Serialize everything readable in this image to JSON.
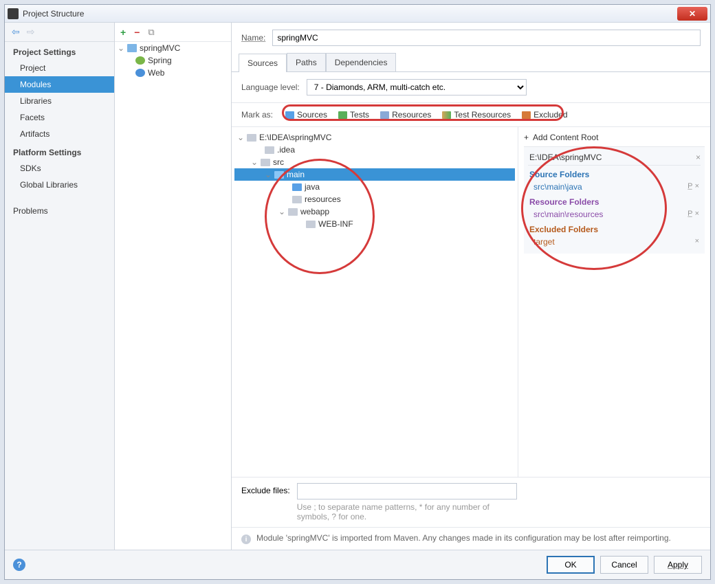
{
  "window": {
    "title": "Project Structure"
  },
  "sidebar": {
    "sections": [
      {
        "title": "Project Settings",
        "items": [
          "Project",
          "Modules",
          "Libraries",
          "Facets",
          "Artifacts"
        ],
        "selected": 1
      },
      {
        "title": "Platform Settings",
        "items": [
          "SDKs",
          "Global Libraries"
        ]
      }
    ],
    "extra": [
      "Problems"
    ]
  },
  "modules": {
    "root": "springMVC",
    "children": [
      "Spring",
      "Web"
    ]
  },
  "name": {
    "label": "Name:",
    "value": "springMVC"
  },
  "tabs": {
    "items": [
      "Sources",
      "Paths",
      "Dependencies"
    ],
    "active": 0
  },
  "language": {
    "label": "Language level:",
    "selected": "7 - Diamonds, ARM, multi-catch etc."
  },
  "markAs": {
    "label": "Mark as:",
    "options": [
      "Sources",
      "Tests",
      "Resources",
      "Test Resources",
      "Excluded"
    ]
  },
  "tree": {
    "root": "E:\\IDEA\\springMVC",
    "nodes": [
      ".idea",
      "src",
      "main",
      "java",
      "resources",
      "webapp",
      "WEB-INF"
    ]
  },
  "roots": {
    "addLabel": "Add Content Root",
    "contentRoot": "E:\\IDEA\\springMVC",
    "sourceFolders": {
      "title": "Source Folders",
      "items": [
        "src\\main\\java"
      ]
    },
    "resourceFolders": {
      "title": "Resource Folders",
      "items": [
        "src\\main\\resources"
      ]
    },
    "excludedFolders": {
      "title": "Excluded Folders",
      "items": [
        "target"
      ]
    }
  },
  "exclude": {
    "label": "Exclude files:",
    "help": "Use ; to separate name patterns, * for any number of symbols, ? for one."
  },
  "info": "Module 'springMVC' is imported from Maven. Any changes made in its configuration may be lost after reimporting.",
  "footer": {
    "ok": "OK",
    "cancel": "Cancel",
    "apply": "Apply"
  }
}
